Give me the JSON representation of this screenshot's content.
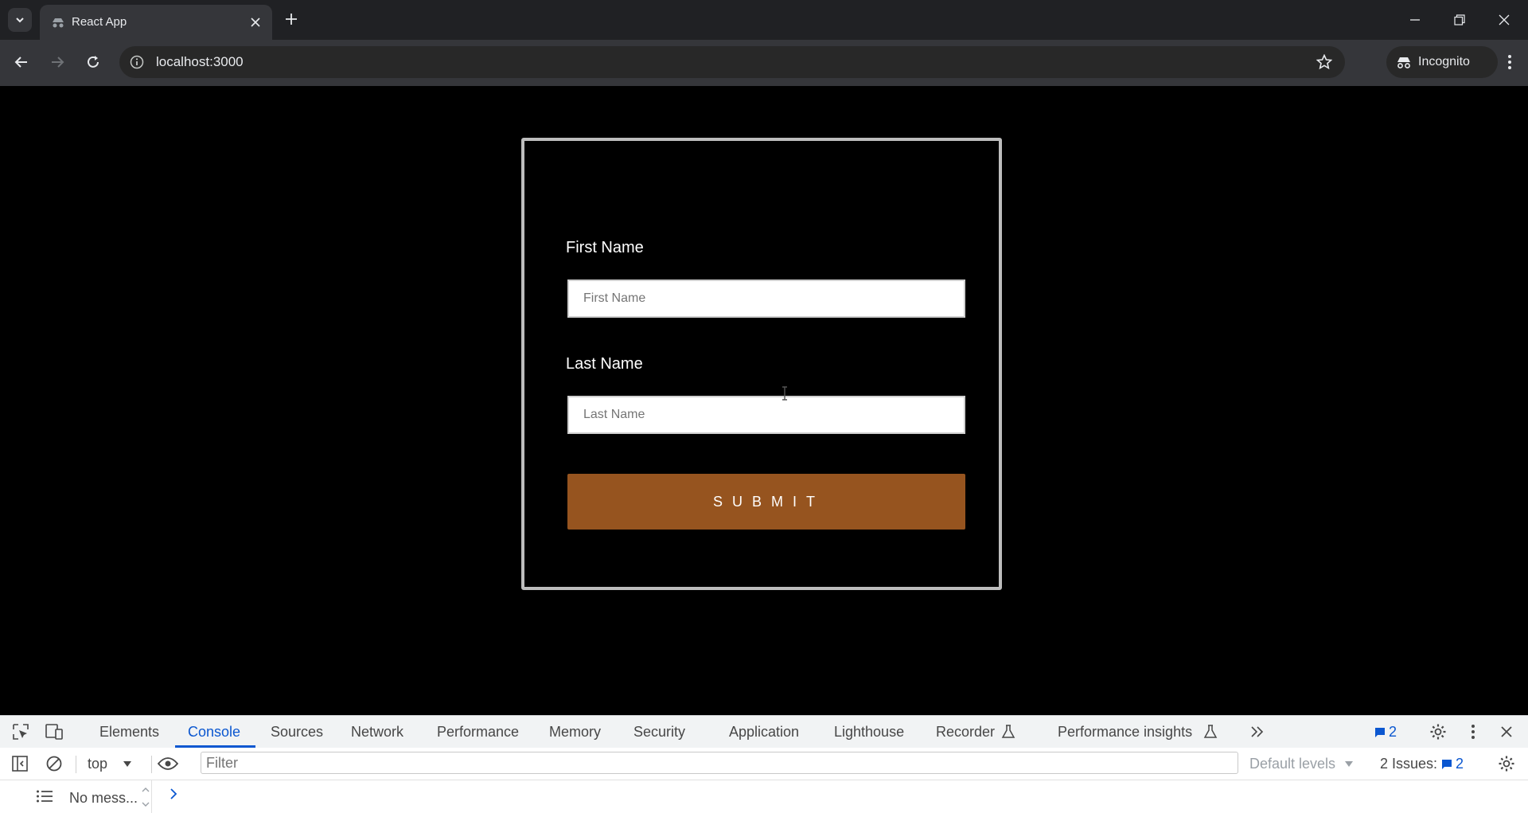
{
  "browser": {
    "tab_title": "React App",
    "url": "localhost:3000",
    "incognito_label": "Incognito"
  },
  "form": {
    "first_name_label": "First Name",
    "first_name_placeholder": "First Name",
    "last_name_label": "Last Name",
    "last_name_placeholder": "Last Name",
    "submit_label": "SUBMIT",
    "submit_color": "#96541f"
  },
  "devtools": {
    "tabs": [
      "Elements",
      "Console",
      "Sources",
      "Network",
      "Performance",
      "Memory",
      "Security",
      "Application",
      "Lighthouse",
      "Recorder",
      "Performance insights"
    ],
    "active_tab": "Console",
    "messages_badge": "2",
    "context": "top",
    "filter_placeholder": "Filter",
    "levels": "Default levels",
    "issues_label": "2 Issues:",
    "issues_count": "2",
    "sidebar_status": "No mess..."
  }
}
